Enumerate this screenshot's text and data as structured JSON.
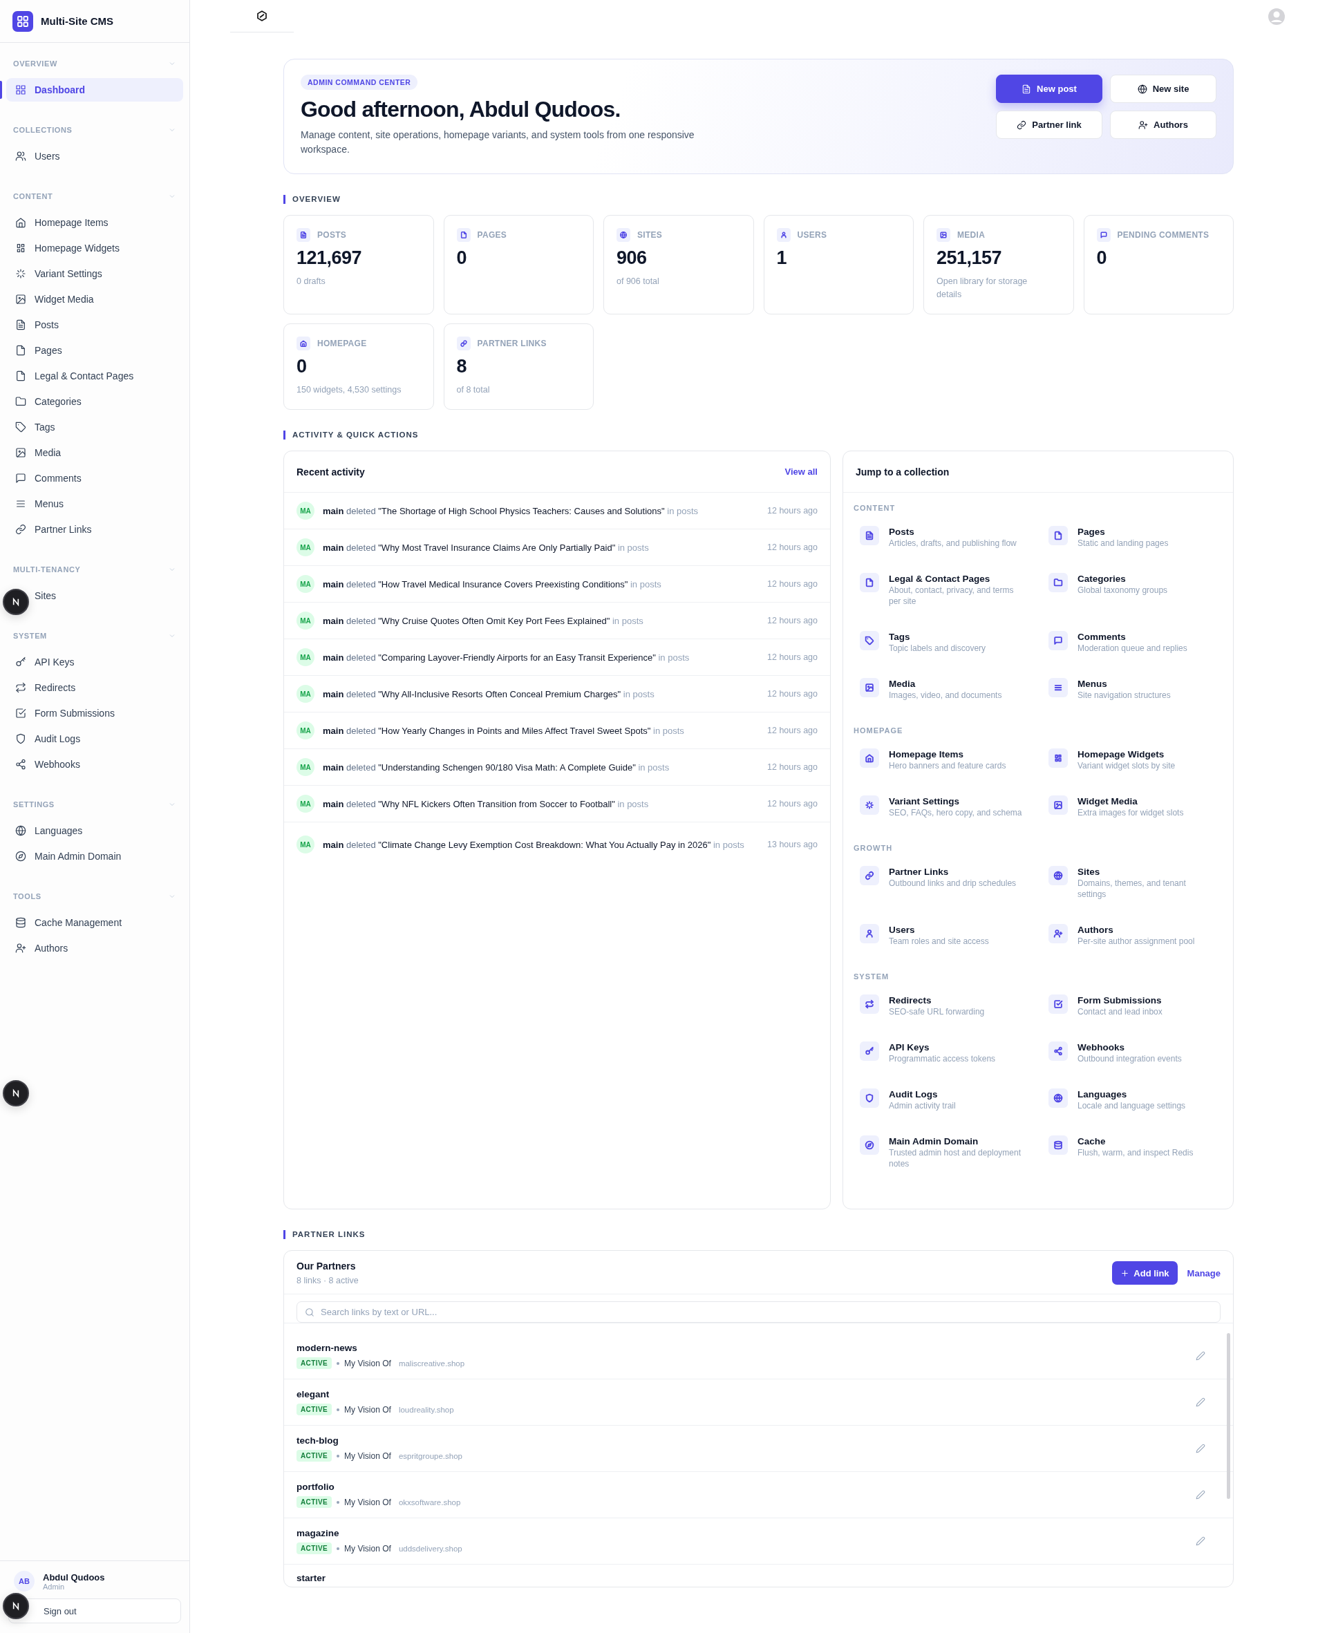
{
  "app": {
    "name": "Multi-Site CMS"
  },
  "sidebar": {
    "sections": [
      {
        "title": "OVERVIEW",
        "expanded": true,
        "items": [
          {
            "label": "Dashboard",
            "selected": true
          }
        ]
      },
      {
        "title": "COLLECTIONS",
        "expanded": true,
        "items": [
          {
            "label": "Users",
            "selected": false
          }
        ]
      },
      {
        "title": "CONTENT",
        "expanded": true,
        "items": [
          {
            "label": "Homepage Items",
            "selected": false
          },
          {
            "label": "Homepage Widgets",
            "selected": false
          },
          {
            "label": "Variant Settings",
            "selected": false
          },
          {
            "label": "Widget Media",
            "selected": false
          },
          {
            "label": "Posts",
            "selected": false
          },
          {
            "label": "Pages",
            "selected": false
          },
          {
            "label": "Legal & Contact Pages",
            "selected": false
          },
          {
            "label": "Categories",
            "selected": false
          },
          {
            "label": "Tags",
            "selected": false
          },
          {
            "label": "Media",
            "selected": false
          },
          {
            "label": "Comments",
            "selected": false
          },
          {
            "label": "Menus",
            "selected": false
          },
          {
            "label": "Partner Links",
            "selected": false
          }
        ]
      },
      {
        "title": "MULTI-TENANCY",
        "expanded": true,
        "items": [
          {
            "label": "Sites",
            "selected": false
          }
        ]
      },
      {
        "title": "SYSTEM",
        "expanded": true,
        "items": [
          {
            "label": "API Keys",
            "selected": false
          },
          {
            "label": "Redirects",
            "selected": false
          },
          {
            "label": "Form Submissions",
            "selected": false
          },
          {
            "label": "Audit Logs",
            "selected": false
          },
          {
            "label": "Webhooks",
            "selected": false
          }
        ]
      },
      {
        "title": "SETTINGS",
        "expanded": true,
        "items": [
          {
            "label": "Languages",
            "selected": false
          },
          {
            "label": "Main Admin Domain",
            "selected": false
          }
        ]
      },
      {
        "title": "TOOLS",
        "expanded": true,
        "items": [
          {
            "label": "Cache Management",
            "selected": false
          },
          {
            "label": "Authors",
            "selected": false
          }
        ]
      }
    ],
    "user": {
      "initials": "AB",
      "name": "Abdul Qudoos",
      "role": "Admin"
    },
    "sign_out": "Sign out"
  },
  "hero": {
    "badge": "ADMIN COMMAND CENTER",
    "title": "Good afternoon, Abdul Qudoos.",
    "description": "Manage content, site operations, homepage variants, and system tools from one responsive workspace.",
    "buttons": [
      {
        "label": "New post",
        "primary": true
      },
      {
        "label": "New site",
        "primary": false
      },
      {
        "label": "Partner link",
        "primary": false
      },
      {
        "label": "Authors",
        "primary": false
      }
    ]
  },
  "overview": {
    "title": "OVERVIEW",
    "stats": [
      {
        "label": "POSTS",
        "value": "121,697",
        "note": "0 drafts"
      },
      {
        "label": "PAGES",
        "value": "0"
      },
      {
        "label": "SITES",
        "value": "906",
        "note": "of 906 total"
      },
      {
        "label": "USERS",
        "value": "1"
      },
      {
        "label": "MEDIA",
        "value": "251,157",
        "note": "Open library for storage details"
      },
      {
        "label": "PENDING COMMENTS",
        "value": "0"
      },
      {
        "label": "HOMEPAGE",
        "value": "0",
        "note": "150 widgets, 4,530 settings"
      },
      {
        "label": "PARTNER LINKS",
        "value": "8",
        "note": "of 8 total"
      }
    ]
  },
  "activity_section": {
    "title": "ACTIVITY & QUICK ACTIONS"
  },
  "recent_activity": {
    "title": "Recent activity",
    "view_all": "View all",
    "rows": [
      {
        "initials": "MA",
        "actor": "main",
        "action": "deleted",
        "subject": "\"The Shortage of High School Physics Teachers: Causes and Solutions\"",
        "context": "in posts",
        "time": "12 hours ago"
      },
      {
        "initials": "MA",
        "actor": "main",
        "action": "deleted",
        "subject": "\"Why Most Travel Insurance Claims Are Only Partially Paid\"",
        "context": "in posts",
        "time": "12 hours ago"
      },
      {
        "initials": "MA",
        "actor": "main",
        "action": "deleted",
        "subject": "\"How Travel Medical Insurance Covers Preexisting Conditions\"",
        "context": "in posts",
        "time": "12 hours ago"
      },
      {
        "initials": "MA",
        "actor": "main",
        "action": "deleted",
        "subject": "\"Why Cruise Quotes Often Omit Key Port Fees Explained\"",
        "context": "in posts",
        "time": "12 hours ago"
      },
      {
        "initials": "MA",
        "actor": "main",
        "action": "deleted",
        "subject": "\"Comparing Layover-Friendly Airports for an Easy Transit Experience\"",
        "context": "in posts",
        "time": "12 hours ago"
      },
      {
        "initials": "MA",
        "actor": "main",
        "action": "deleted",
        "subject": "\"Why All-Inclusive Resorts Often Conceal Premium Charges\"",
        "context": "in posts",
        "time": "12 hours ago"
      },
      {
        "initials": "MA",
        "actor": "main",
        "action": "deleted",
        "subject": "\"How Yearly Changes in Points and Miles Affect Travel Sweet Spots\"",
        "context": "in posts",
        "time": "12 hours ago"
      },
      {
        "initials": "MA",
        "actor": "main",
        "action": "deleted",
        "subject": "\"Understanding Schengen 90/180 Visa Math: A Complete Guide\"",
        "context": "in posts",
        "time": "12 hours ago"
      },
      {
        "initials": "MA",
        "actor": "main",
        "action": "deleted",
        "subject": "\"Why NFL Kickers Often Transition from Soccer to Football\"",
        "context": "in posts",
        "time": "12 hours ago"
      },
      {
        "initials": "MA",
        "actor": "main",
        "action": "deleted",
        "subject": "\"Climate Change Levy Exemption Cost Breakdown: What You Actually Pay in 2026\"",
        "context": "in posts",
        "time": "13 hours ago"
      }
    ]
  },
  "jump": {
    "title": "Jump to a collection",
    "groups": [
      {
        "title": "CONTENT",
        "items": [
          {
            "title": "Posts",
            "description": "Articles, drafts, and publishing flow"
          },
          {
            "title": "Pages",
            "description": "Static and landing pages"
          },
          {
            "title": "Legal & Contact Pages",
            "description": "About, contact, privacy, and terms per site"
          },
          {
            "title": "Categories",
            "description": "Global taxonomy groups"
          },
          {
            "title": "Tags",
            "description": "Topic labels and discovery"
          },
          {
            "title": "Comments",
            "description": "Moderation queue and replies"
          },
          {
            "title": "Media",
            "description": "Images, video, and documents"
          },
          {
            "title": "Menus",
            "description": "Site navigation structures"
          }
        ]
      },
      {
        "title": "HOMEPAGE",
        "items": [
          {
            "title": "Homepage Items",
            "description": "Hero banners and feature cards"
          },
          {
            "title": "Homepage Widgets",
            "description": "Variant widget slots by site"
          },
          {
            "title": "Variant Settings",
            "description": "SEO, FAQs, hero copy, and schema"
          },
          {
            "title": "Widget Media",
            "description": "Extra images for widget slots"
          }
        ]
      },
      {
        "title": "GROWTH",
        "items": [
          {
            "title": "Partner Links",
            "description": "Outbound links and drip schedules"
          },
          {
            "title": "Sites",
            "description": "Domains, themes, and tenant settings"
          },
          {
            "title": "Users",
            "description": "Team roles and site access"
          },
          {
            "title": "Authors",
            "description": "Per-site author assignment pool"
          }
        ]
      },
      {
        "title": "SYSTEM",
        "items": [
          {
            "title": "Redirects",
            "description": "SEO-safe URL forwarding"
          },
          {
            "title": "Form Submissions",
            "description": "Contact and lead inbox"
          },
          {
            "title": "API Keys",
            "description": "Programmatic access tokens"
          },
          {
            "title": "Webhooks",
            "description": "Outbound integration events"
          },
          {
            "title": "Audit Logs",
            "description": "Admin activity trail"
          },
          {
            "title": "Languages",
            "description": "Locale and language settings"
          },
          {
            "title": "Main Admin Domain",
            "description": "Trusted admin host and deployment notes"
          },
          {
            "title": "Cache",
            "description": "Flush, warm, and inspect Redis"
          }
        ]
      }
    ]
  },
  "partner_section": {
    "title": "PARTNER LINKS"
  },
  "partners": {
    "title": "Our Partners",
    "summary": "8 links · 8 active",
    "add_button": "Add link",
    "manage": "Manage",
    "search": {
      "placeholder": "Search links by text or URL..."
    },
    "links": [
      {
        "name": "modern-news",
        "status": "ACTIVE",
        "anchor": "My Vision Of",
        "domain": "maliscreative.shop"
      },
      {
        "name": "elegant",
        "status": "ACTIVE",
        "anchor": "My Vision Of",
        "domain": "loudreality.shop"
      },
      {
        "name": "tech-blog",
        "status": "ACTIVE",
        "anchor": "My Vision Of",
        "domain": "espritgroupe.shop"
      },
      {
        "name": "portfolio",
        "status": "ACTIVE",
        "anchor": "My Vision Of",
        "domain": "okxsoftware.shop"
      },
      {
        "name": "magazine",
        "status": "ACTIVE",
        "anchor": "My Vision Of",
        "domain": "uddsdelivery.shop"
      },
      {
        "name": "starter"
      }
    ]
  }
}
